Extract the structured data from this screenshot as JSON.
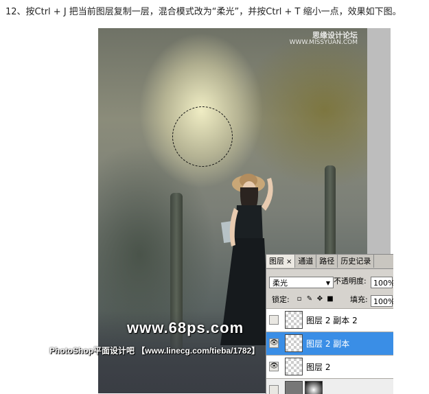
{
  "instruction": "12、按Ctrl + J 把当前图层复制一层，混合模式改为“柔光”，并按Ctrl + T 缩小一点，效果如下图。",
  "watermarks": {
    "top_line1": "思缘设计论坛",
    "top_line2": "WWW.MISSYUAN.COM",
    "site": "www.68ps.com",
    "bar": "PhotoShop平面设计吧 【www.linecg.com/tieba/1782】"
  },
  "layers_panel": {
    "tabs": [
      {
        "label": "图层",
        "close": "×",
        "active": true
      },
      {
        "label": "通道",
        "active": false
      },
      {
        "label": "路径",
        "active": false
      },
      {
        "label": "历史记录",
        "active": false
      }
    ],
    "blend_mode": "柔光",
    "opacity_label": "不透明度:",
    "opacity_value": "100%",
    "lock_label": "锁定:",
    "fill_label": "填充:",
    "fill_value": "100%",
    "lock_icons": [
      "lock-transparent-icon",
      "lock-paint-icon",
      "lock-move-icon",
      "lock-all-icon"
    ],
    "layers": [
      {
        "name": "图层 2 副本 2",
        "visible": false,
        "selected": false
      },
      {
        "name": "图层 2 副本",
        "visible": true,
        "selected": true
      },
      {
        "name": "图层 2",
        "visible": true,
        "selected": false
      }
    ],
    "eye_glyph": "👁",
    "accent_color": "#3a8ee6"
  }
}
